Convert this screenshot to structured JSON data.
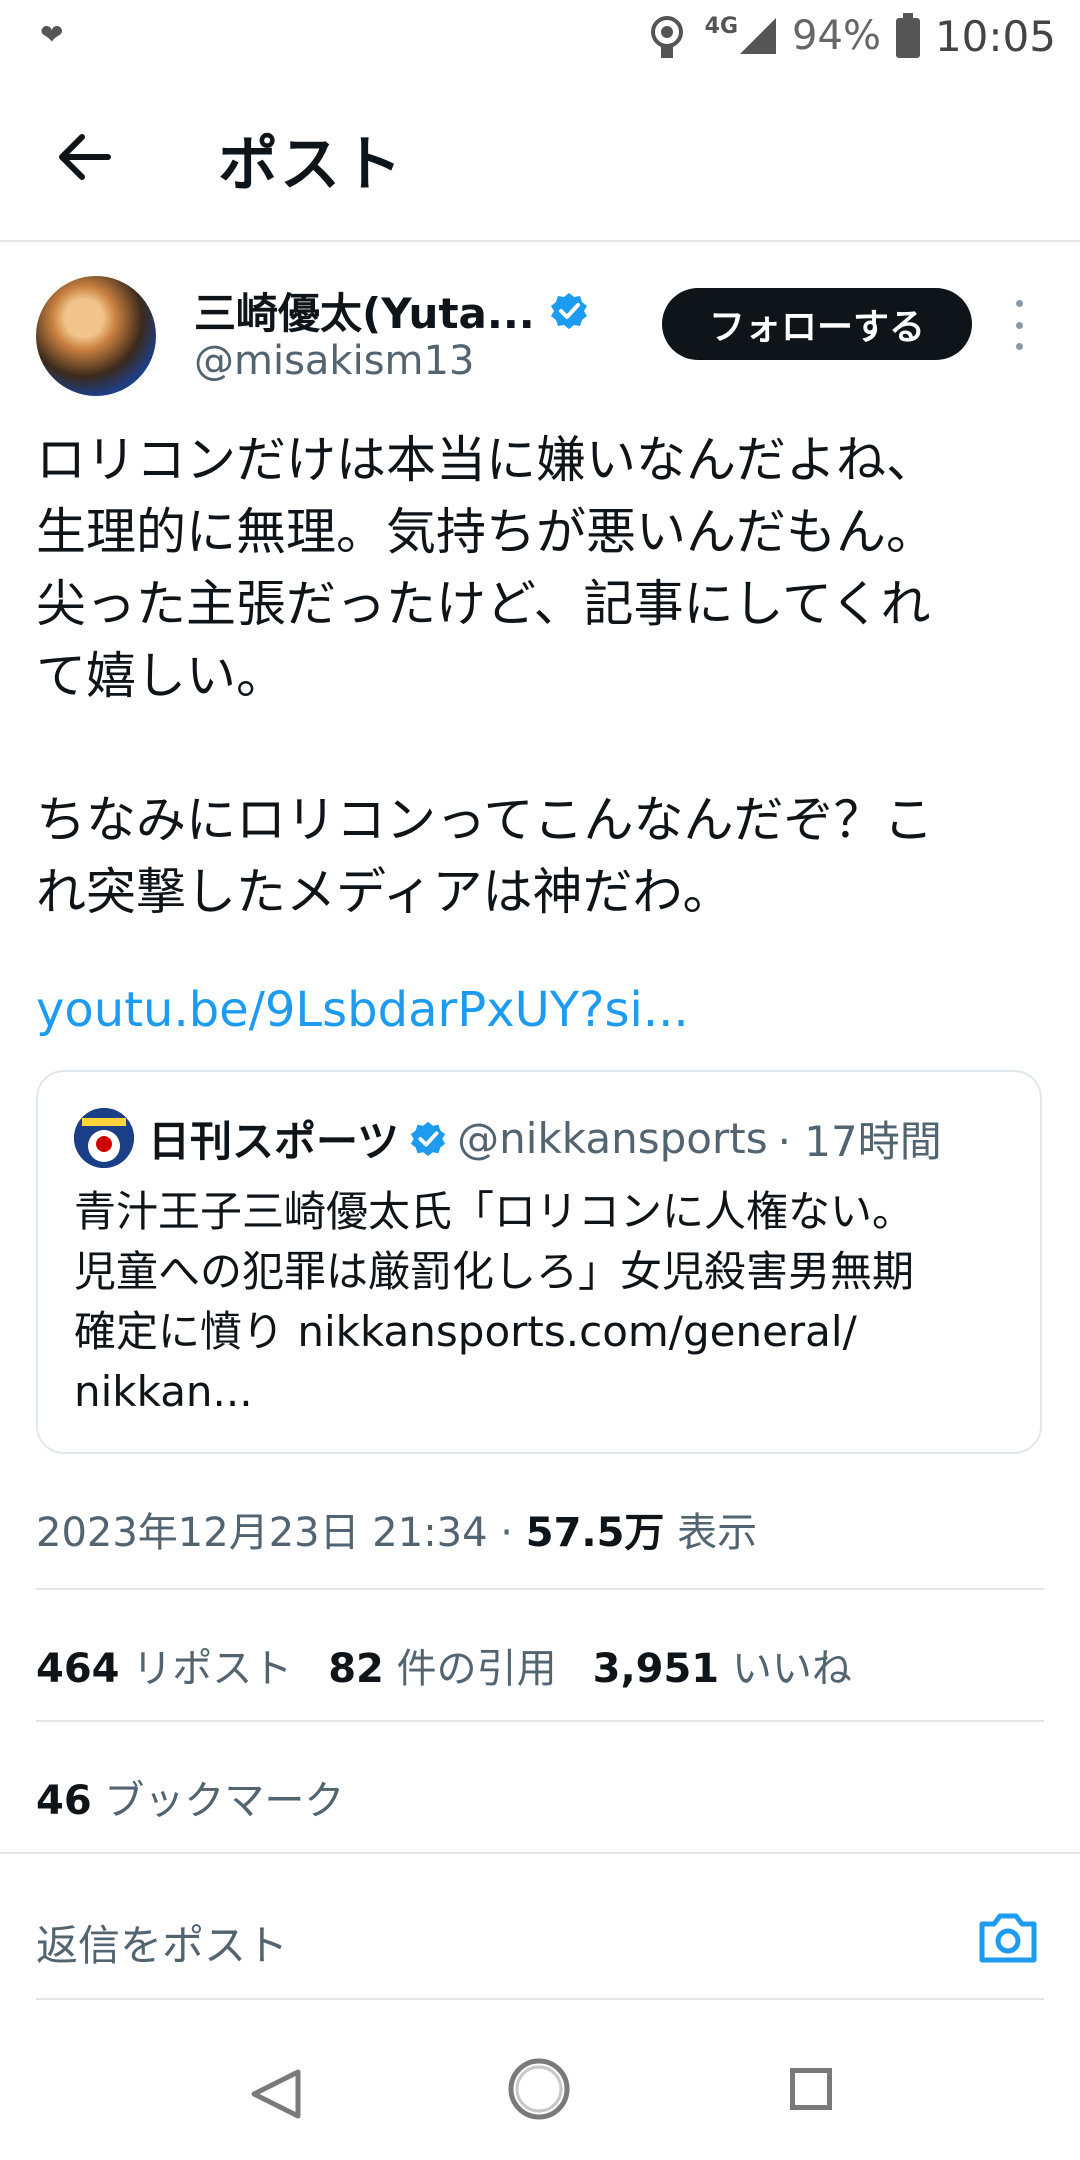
{
  "status_bar": {
    "network": "4G",
    "battery": "94%",
    "time": "10:05"
  },
  "header": {
    "title": "ポスト"
  },
  "author": {
    "name": "三崎優太(Yuta...",
    "handle": "@misakism13",
    "follow_label": "フォローする",
    "verified": true
  },
  "post": {
    "text": "ロリコンだけは本当に嫌いなんだよね、\n生理的に無理。気持ちが悪いんだもん。\n尖った主張だったけど、記事にしてくれ\nて嬉しい。\n\nちなみにロリコンってこんなんだぞ？こ\nれ突撃したメディアは神だわ。",
    "link": "youtu.be/9LsbdarPxUY?si..."
  },
  "quote": {
    "name": "日刊スポーツ",
    "handle": "@nikkansports",
    "time": "· 17時間",
    "text": "青汁王子三崎優太氏「ロリコンに人権ない。\n児童への犯罪は厳罰化しろ」女児殺害男無期\n確定に憤り nikkansports.com/general/\nnikkan..."
  },
  "meta": {
    "datetime": "2023年12月23日 21:34 · ",
    "views": "57.5万",
    "views_label": " 表示"
  },
  "stats": {
    "reposts": "464",
    "reposts_label": "リポスト",
    "quotes": "82",
    "quotes_label": "件の引用",
    "likes": "3,951",
    "likes_label": "いいね",
    "bookmarks": "46",
    "bookmarks_label": "ブックマーク"
  },
  "reply": {
    "placeholder": "返信をポスト"
  },
  "colors": {
    "accent": "#1d9bf0",
    "text": "#0f1419",
    "muted": "#536471"
  }
}
